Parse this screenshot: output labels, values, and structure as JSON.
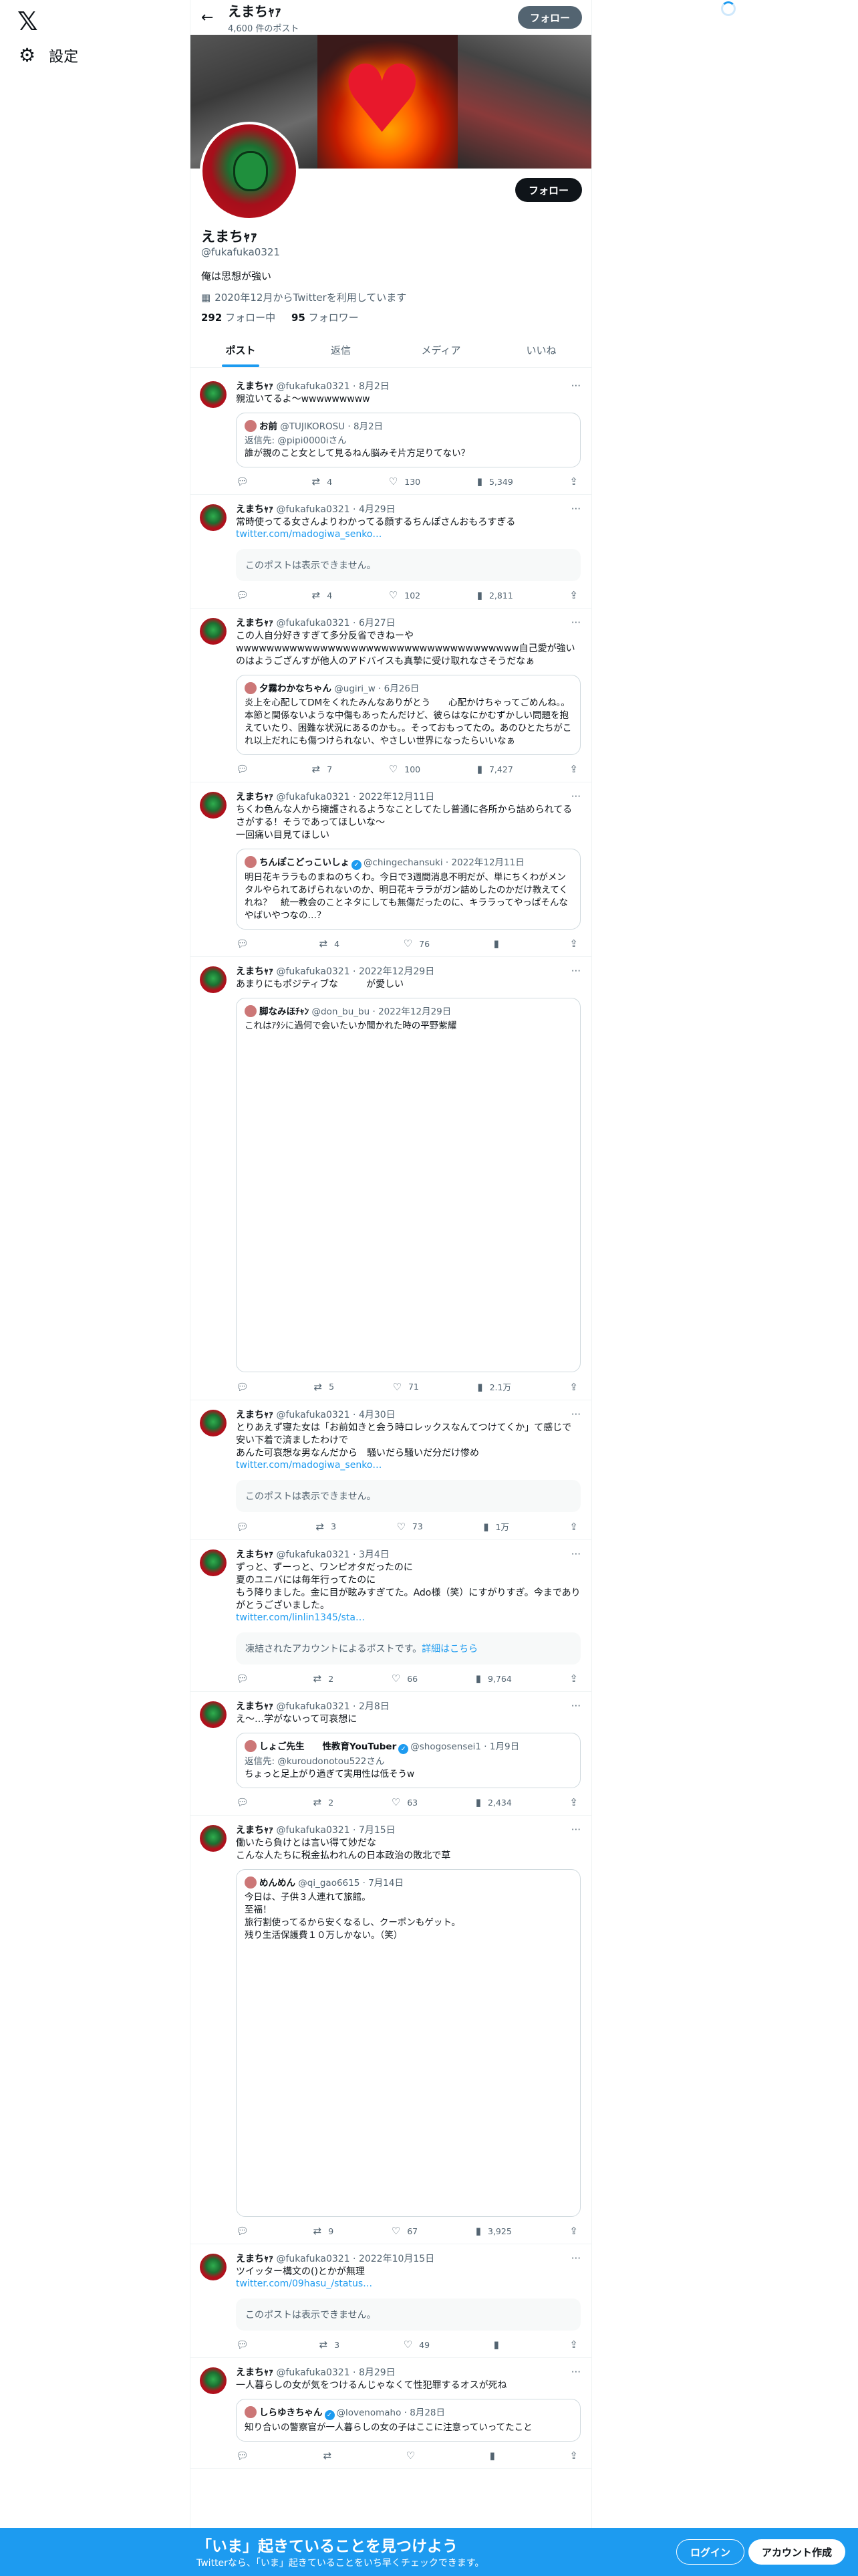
{
  "nav": {
    "logo": "𝕏",
    "settings_label": "設定"
  },
  "header": {
    "name": "えまちｬｧ",
    "post_count": "4,600 件のポスト",
    "follow_label": "フォロー"
  },
  "profile": {
    "name": "えまちｬｧ",
    "handle": "@fukafuka0321",
    "bio": "俺は思想が強い",
    "joined": "2020年12月からTwitterを利用しています",
    "following_count": "292",
    "following_label": "フォロー中",
    "followers_count": "95",
    "followers_label": "フォロワー",
    "follow_label": "フォロー"
  },
  "tabs": [
    {
      "label": "ポスト"
    },
    {
      "label": "返信"
    },
    {
      "label": "メディア"
    },
    {
      "label": "いいね"
    }
  ],
  "tweets": [
    {
      "name": "えまちｬｧ",
      "handle": "@fukafuka0321",
      "date": "8月2日",
      "text": "親泣いてるよ〜wwwwwwwww",
      "quote": {
        "name": "お前",
        "handle": "@TUJIKOROSU",
        "date": "8月2日",
        "reply_to": "返信先: @pipi0000iさん",
        "text": "誰が親のこと女として見るねん脳みそ片方足りてない？"
      },
      "replies": "",
      "reposts": "4",
      "likes": "130",
      "views": "5,349"
    },
    {
      "name": "えまちｬｧ",
      "handle": "@fukafuka0321",
      "date": "4月29日",
      "text": "常時使ってる女さんよりわかってる顔するちんぽさんおもろすぎる",
      "link": "twitter.com/madogiwa_senko…",
      "unavailable": "このポストは表示できません。",
      "replies": "",
      "reposts": "4",
      "likes": "102",
      "views": "2,811"
    },
    {
      "name": "えまちｬｧ",
      "handle": "@fukafuka0321",
      "date": "6月27日",
      "text": "この人自分好きすぎて多分反省できねーや\nwwwwwwwwwwwwwwwwwwwwwwwwwwwwwwwwwwwww自己愛が強いのはようござんすが他人のアドバイスも真摯に受け取れなさそうだなぁ",
      "quote": {
        "name": "夕霧わかなちゃん",
        "handle": "@ugiri_w",
        "date": "6月26日",
        "text": "炎上を心配してDMをくれたみんなありがとう　　心配かけちゃってごめんね。。本節と関係ないような中傷もあったんだけど、彼らはなにかむずかしい問題を抱えていたり、困難な状況にあるのかも。。そっておもってたの。あのひとたちがこれ以上だれにも傷つけられない、やさしい世界になったらいいなぁ"
      },
      "replies": "",
      "reposts": "7",
      "likes": "100",
      "views": "7,427"
    },
    {
      "name": "えまちｬｧ",
      "handle": "@fukafuka0321",
      "date": "2022年12月11日",
      "text": "ちくわ色んな人から擁護されるようなことしてたし普通に各所から詰められてるさがする！そうであってほしいな〜\n一回痛い目見てほしい",
      "quote": {
        "name": "ちんぽこどっこいしょ",
        "verified": true,
        "handle": "@chingechansuki",
        "date": "2022年12月11日",
        "text": "明日花キララものまねのちくわ。今日で3週間消息不明だが、単にちくわがメンタルやられてあげられないのか、明日花キララがガン詰めしたのかだけ教えてくれね？　統一教会のことネタにしても無傷だったのに、キララってやっぱそんなやばいやつなの…？"
      },
      "replies": "",
      "reposts": "4",
      "likes": "76",
      "views": ""
    },
    {
      "name": "えまちｬｧ",
      "handle": "@fukafuka0321",
      "date": "2022年12月29日",
      "text": "あまりにもポジティブな　　　が愛しい",
      "quote": {
        "name": "脚なみほﾁｬﾝ",
        "handle": "@don_bu_bu",
        "date": "2022年12月29日",
        "text": "これはｱﾀｼに過何で会いたいか聞かれた時の平野紫耀",
        "tall": "media"
      },
      "replies": "",
      "reposts": "5",
      "likes": "71",
      "views": "2.1万"
    },
    {
      "name": "えまちｬｧ",
      "handle": "@fukafuka0321",
      "date": "4月30日",
      "text": "とりあえず寝た女は「お前如きと会う時ロレックスなんてつけてくか」て感じで安い下着で済ましたわけで\nあんた可哀想な男なんだから　騒いだら騒いだ分だけ惨め",
      "link": "twitter.com/madogiwa_senko…",
      "unavailable": "このポストは表示できません。",
      "replies": "",
      "reposts": "3",
      "likes": "73",
      "views": "1万"
    },
    {
      "name": "えまちｬｧ",
      "handle": "@fukafuka0321",
      "date": "3月4日",
      "text": "ずっと、ずーっと、ワンピオタだったのに\n夏のユニバには毎年行ってたのに\nもう降りました。金に目が眩みすぎてた。Ado様（笑）にすがりすぎ。今までありがとうございました。",
      "link": "twitter.com/linlin1345/sta…",
      "unavailable": "凍結されたアカウントによるポストです。",
      "unavailable_link": "詳細はこちら",
      "replies": "",
      "reposts": "2",
      "likes": "66",
      "views": "9,764"
    },
    {
      "name": "えまちｬｧ",
      "handle": "@fukafuka0321",
      "date": "2月8日",
      "text": "え〜…学がないって可哀想に",
      "quote": {
        "name": "しょご先生　　性教育YouTuber",
        "verified": true,
        "handle": "@shogosensei1",
        "date": "1月9日",
        "reply_to": "返信先: @kuroudonotou522さん",
        "text": "ちょっと足上がり過ぎて実用性は低そうw"
      },
      "replies": "",
      "reposts": "2",
      "likes": "63",
      "views": "2,434"
    },
    {
      "name": "えまちｬｧ",
      "handle": "@fukafuka0321",
      "date": "7月15日",
      "text": "働いたら負けとは言い得て妙だな\nこんな人たちに税金払われんの日本政治の敗北で草",
      "quote": {
        "name": "めんめん",
        "handle": "@qi_gao6615",
        "date": "7月14日",
        "text": "今日は、子供３人連れて旅館。\n至福！\n旅行割使ってるから安くなるし、クーポンもゲット。\n残り生活保護費１０万しかない。（笑）",
        "tall": "media2"
      },
      "replies": "",
      "reposts": "9",
      "likes": "67",
      "views": "3,925"
    },
    {
      "name": "えまちｬｧ",
      "handle": "@fukafuka0321",
      "date": "2022年10月15日",
      "text": "ツイッター構文の()とかが無理",
      "link": "twitter.com/09hasu_/status…",
      "unavailable": "このポストは表示できません。",
      "replies": "",
      "reposts": "3",
      "likes": "49",
      "views": ""
    },
    {
      "name": "えまちｬｧ",
      "handle": "@fukafuka0321",
      "date": "8月29日",
      "text": "一人暮らしの女が気をつけるんじゃなくて性犯罪するオスが死ね",
      "quote": {
        "name": "しらゆきちゃん",
        "verified": true,
        "handle": "@lovenomaho",
        "date": "8月28日",
        "text": "知り合いの警察官が一人暮らしの女の子はここに注意っていってたこと"
      },
      "replies": "",
      "reposts": "",
      "likes": "",
      "views": ""
    }
  ],
  "bottom_bar": {
    "title": "「いま」起きていることを見つけよう",
    "subtitle": "Twitterなら、「いま」起きていることをいち早くチェックできます。",
    "login_label": "ログイン",
    "signup_label": "アカウント作成"
  }
}
